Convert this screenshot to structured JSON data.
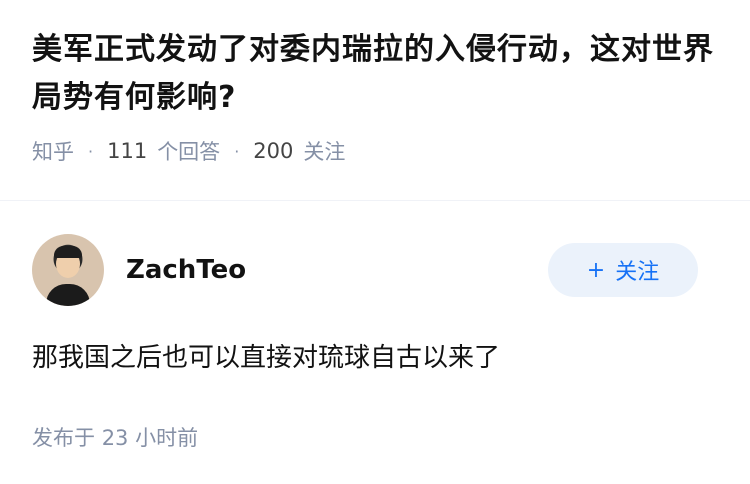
{
  "question": {
    "title": "美军正式发动了对委内瑞拉的入侵行动，这对世界局势有何影响?",
    "source": "知乎",
    "answer_count": "111",
    "answer_label": "个回答",
    "follower_count": "200",
    "follower_label": "关注"
  },
  "answer": {
    "author_name": "ZachTeo",
    "follow_label": "关注",
    "follow_icon": "plus-icon",
    "content": "那我国之后也可以直接对琉球自古以来了",
    "published_prefix": "发布于",
    "published_time": "23 小时前"
  },
  "colors": {
    "accent": "#1772f6",
    "follow_bg": "#ebf2fb",
    "meta": "#8590a6"
  }
}
